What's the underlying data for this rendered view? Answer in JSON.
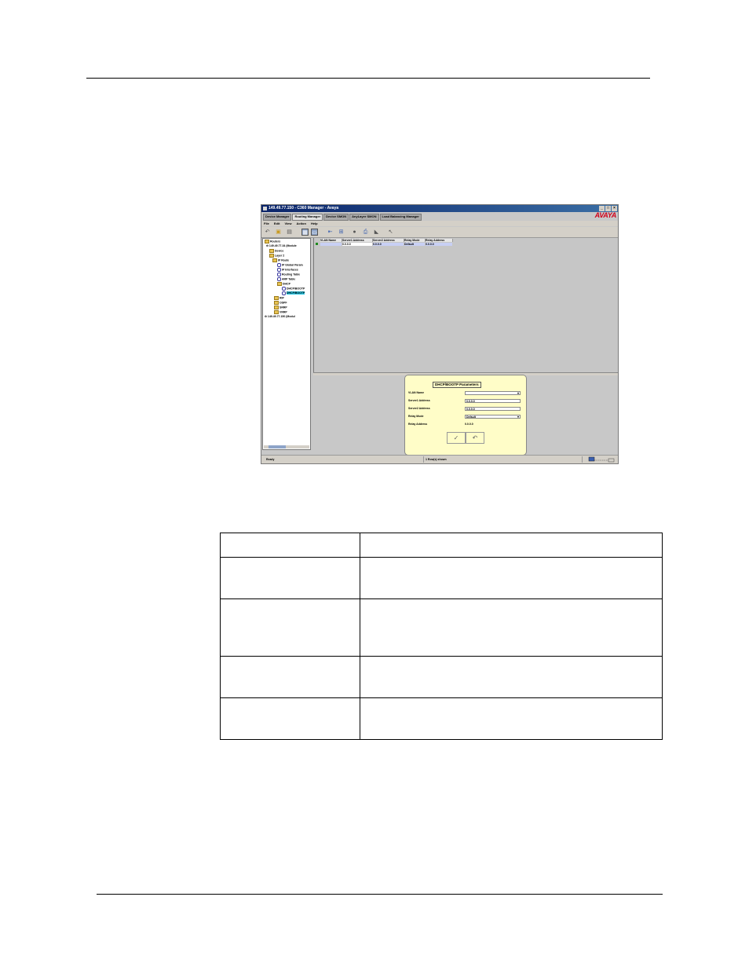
{
  "screenshot": {
    "window_title": "149.49.77.150 - C360 Manager - Avaya",
    "window_controls": [
      "_",
      "□",
      "×"
    ],
    "logo_text": "AVAYA",
    "tabs": [
      "Device Manager",
      "Routing Manager",
      "Device SMON",
      "AnyLayer SMON",
      "Load Balancing Manager"
    ],
    "menu": [
      "File",
      "Edit",
      "View",
      "Action",
      "Help"
    ],
    "toolbar_icons": [
      "undo-icon",
      "copy-icon",
      "paste-icon",
      "table-view-icon",
      "form-view-icon",
      "insert-row-icon",
      "grid-icon",
      "print-icon",
      "record-icon",
      "filter-icon",
      "help-pointer-icon"
    ],
    "tree": {
      "items": [
        "Routers",
        "149.49.77.34 (Module",
        "Device",
        "Layer 2",
        "IP Route",
        "IP Global Param",
        "IP Interfaces",
        "Routing Table",
        "ARP Table",
        "DHCP",
        "DHCP/BOOTP",
        "DHCP/BOOTP",
        "RIP",
        "OSPF",
        "SRRP",
        "VRRP",
        "149.49.77.150 (Modul"
      ]
    },
    "grid": {
      "columns": [
        "VLAN Name",
        "Server1 Address",
        "Server2 Address",
        "Relay Mode",
        "Relay Address"
      ],
      "row": [
        "",
        "0.0.0.0",
        "0.0.0.0",
        "Default",
        "0.0.0.0"
      ]
    },
    "dialog": {
      "title": "DHCP/BOOTP Parameters",
      "fields": [
        {
          "label": "VLAN Name",
          "value": ""
        },
        {
          "label": "Server1 Address",
          "value": "0.0.0.0"
        },
        {
          "label": "Server2 Address",
          "value": "0.0.0.0"
        },
        {
          "label": "Relay Mode",
          "value": "Default"
        },
        {
          "label": "Relay Address",
          "value": "0.0.0.0"
        }
      ],
      "ok_glyph": "✓",
      "undo_glyph": "↶"
    },
    "status": {
      "left": "Ready",
      "middle": "1 Row(s) shown"
    }
  },
  "table": {
    "rows": 5,
    "cols": 2
  }
}
